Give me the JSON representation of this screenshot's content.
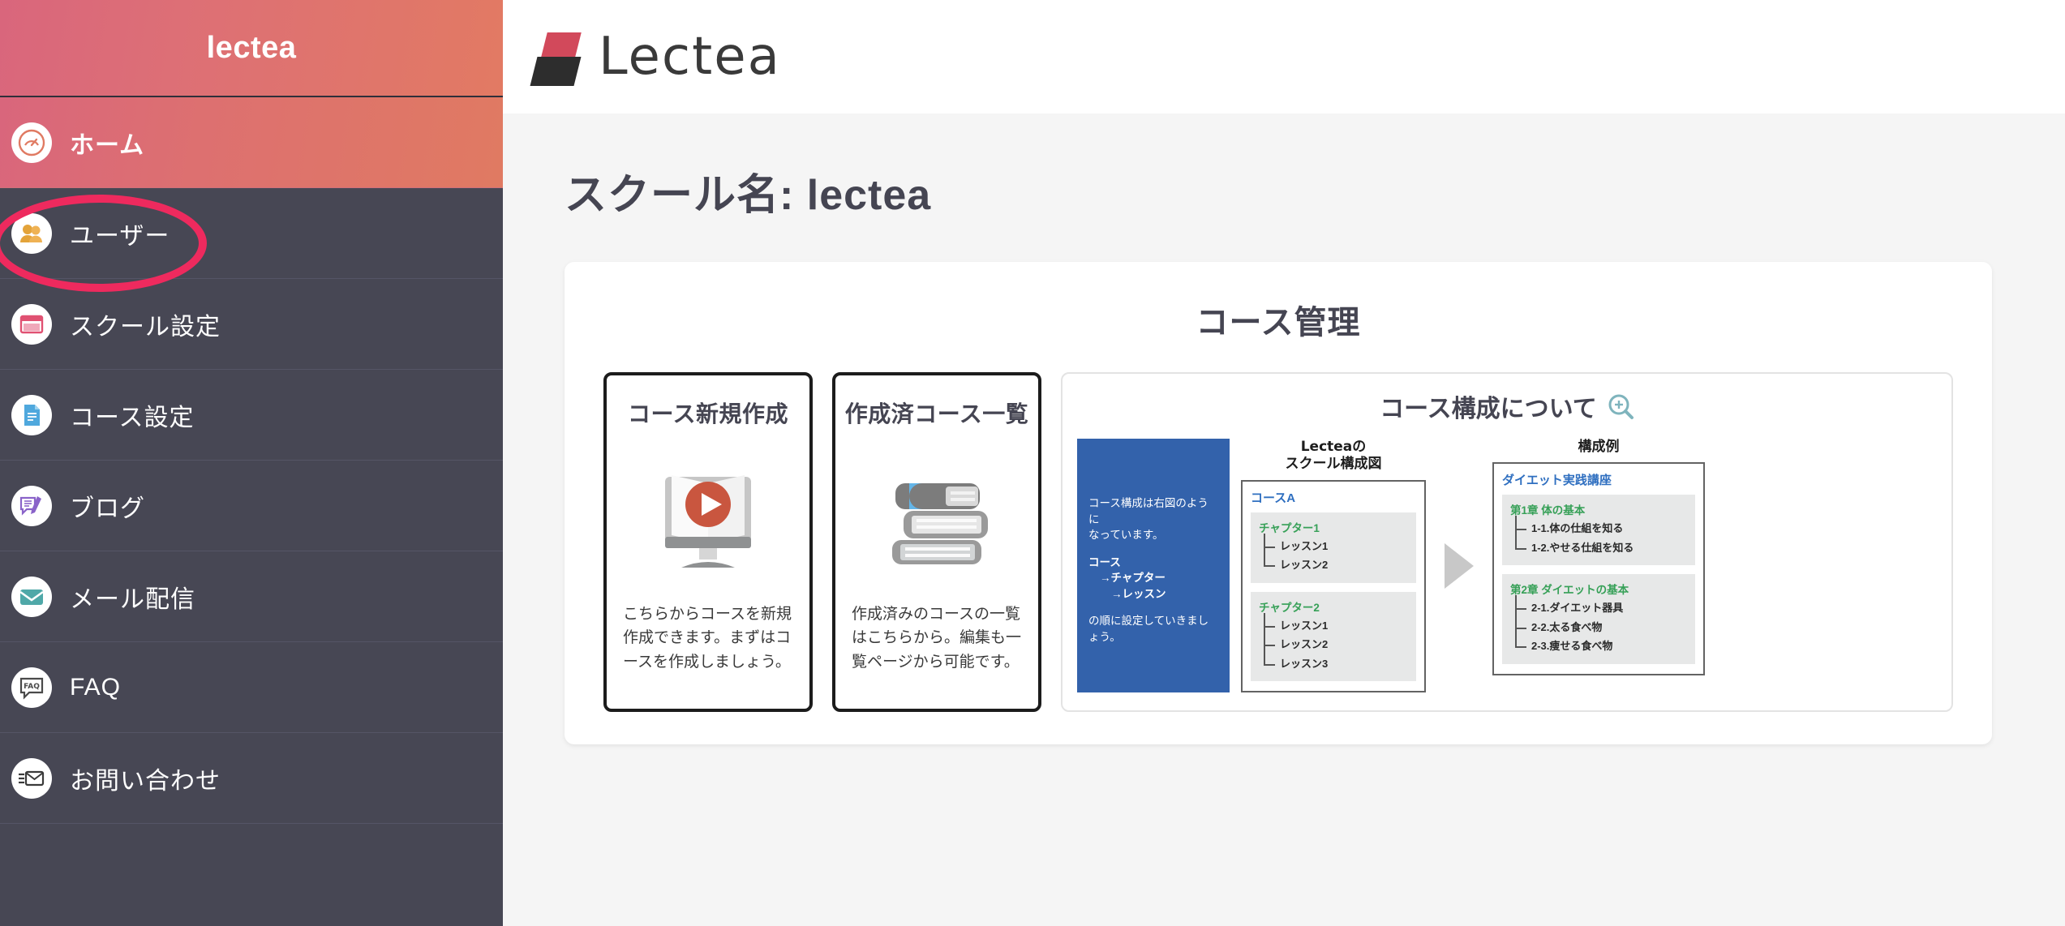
{
  "sidebar": {
    "brand": "lectea",
    "items": [
      {
        "label": "ホーム",
        "icon": "dashboard-icon",
        "active": true
      },
      {
        "label": "ユーザー",
        "icon": "users-icon",
        "active": false
      },
      {
        "label": "スクール設定",
        "icon": "window-icon",
        "active": false
      },
      {
        "label": "コース設定",
        "icon": "document-icon",
        "active": false
      },
      {
        "label": "ブログ",
        "icon": "blog-pencil-icon",
        "active": false
      },
      {
        "label": "メール配信",
        "icon": "mail-icon",
        "active": false
      },
      {
        "label": "FAQ",
        "icon": "faq-icon",
        "active": false
      },
      {
        "label": "お問い合わせ",
        "icon": "contact-mail-icon",
        "active": false
      }
    ]
  },
  "header": {
    "logo_text": "Lectea",
    "logo_icon": "lectea-mark-icon"
  },
  "page": {
    "title": "スクール名: lectea"
  },
  "panel": {
    "title": "コース管理",
    "cards": [
      {
        "title": "コース新規作成",
        "icon": "monitor-play-icon",
        "text": "こちらからコースを新規作成できます。まずはコースを作成しましょう。"
      },
      {
        "title": "作成済コース一覧",
        "icon": "books-stack-icon",
        "text": "作成済みのコースの一覧はこちらから。編集も一覧ページから可能です。"
      }
    ],
    "structure": {
      "title": "コース構成について",
      "title_icon": "zoom-in-icon",
      "note": {
        "line1": "コース構成は右図のように",
        "line2": "なっています。",
        "hier1": "コース",
        "hier2": "→チャプター",
        "hier3": "→レッスン",
        "line3": "の順に設定していきましょう。"
      },
      "diagram_left": {
        "heading_line1": "Lecteaの",
        "heading_line2": "スクール構成図",
        "course": "コースA",
        "chapters": [
          {
            "name": "チャプター1",
            "lessons": [
              "レッスン1",
              "レッスン2"
            ]
          },
          {
            "name": "チャプター2",
            "lessons": [
              "レッスン1",
              "レッスン2",
              "レッスン3"
            ]
          }
        ]
      },
      "arrow_icon": "arrow-right-icon",
      "diagram_right": {
        "heading_line1": "構成例",
        "course": "ダイエット実践講座",
        "chapters": [
          {
            "name": "第1章 体の基本",
            "lessons": [
              "1-1.体の仕組を知る",
              "1-2.やせる仕組を知る"
            ]
          },
          {
            "name": "第2章 ダイエットの基本",
            "lessons": [
              "2-1.ダイエット器具",
              "2-2.太る食べ物",
              "2-3.痩せる食べ物"
            ]
          }
        ]
      }
    }
  },
  "annotation": {
    "type": "ellipse-highlight",
    "color": "#ee2a5e",
    "target": "sidebar-item-users"
  },
  "colors": {
    "sidebar_bg": "#474754",
    "accent_gradient_start": "#d9667c",
    "accent_gradient_end": "#e27a63",
    "diagram_blue": "#3362ab",
    "course_blue": "#2f6fc0",
    "chapter_green": "#36a057",
    "logo_red": "#d2495b",
    "highlight_pink": "#ee2a5e"
  }
}
